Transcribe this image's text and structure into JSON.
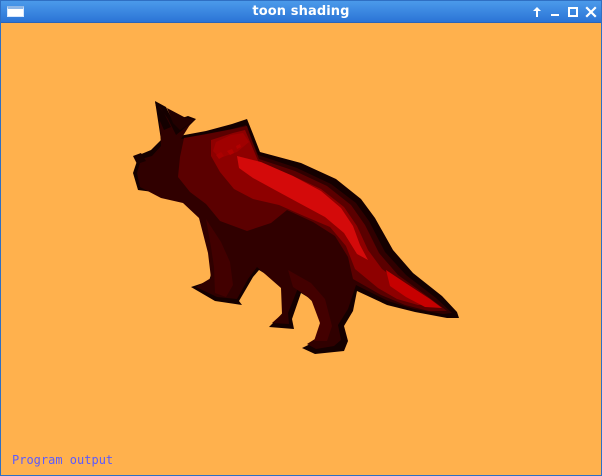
{
  "window": {
    "title": "toon shading",
    "controls": {
      "keep_above": "above-icon",
      "minimize": "minimize-icon",
      "maximize": "maximize-icon",
      "close": "close-icon"
    }
  },
  "content": {
    "background": "#ffb14d",
    "model_colors": {
      "outline": "#140000",
      "dark": "#300000",
      "mid": "#5b0000",
      "red": "#8e0000",
      "bright": "#d40a0a"
    },
    "program_output": "Program output"
  }
}
